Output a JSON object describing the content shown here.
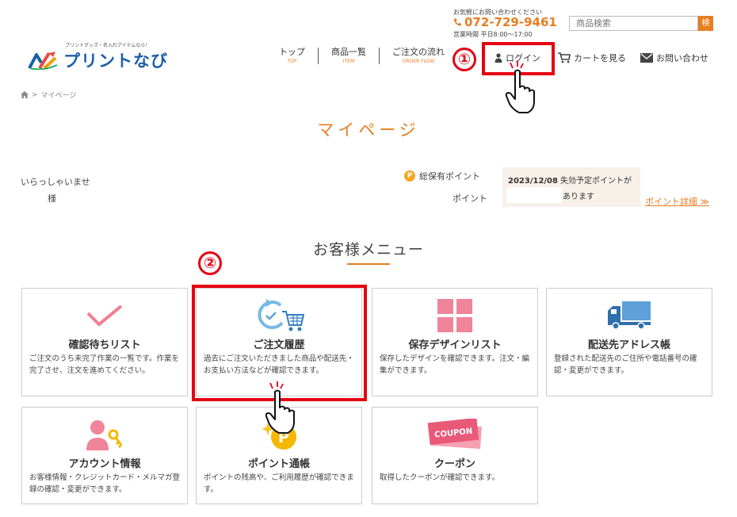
{
  "header": {
    "contact_small": "お気軽にお問い合わせください",
    "phone": "072-729-9461",
    "hours": "営業時間 平日8:00～17:00",
    "search_placeholder": "商品検索",
    "search_button": "検索",
    "logo_tagline": "プリントグッズ・名入れアイテムなら！",
    "logo_text": "プリントなび"
  },
  "nav": [
    {
      "label": "トップ",
      "sub": "TOP"
    },
    {
      "label": "商品一覧",
      "sub": "ITEM"
    },
    {
      "label": "ご注文の流れ",
      "sub": "ORDER FLOW"
    }
  ],
  "header_links": {
    "login": "ログイン",
    "cart": "カートを見る",
    "contact": "お問い合わせ"
  },
  "annotations": {
    "step1": "①",
    "step2": "②"
  },
  "breadcrumb": {
    "current": "マイページ"
  },
  "page_title": "マイページ",
  "welcome": {
    "greeting": "いらっしゃいませ",
    "honorific": "様"
  },
  "points": {
    "icon_letter": "P",
    "title": "総保有ポイント",
    "unit": "ポイント",
    "expiry_date": "2023/12/08",
    "expiry_text": "失効予定ポイントが",
    "expiry_suffix": "あります",
    "detail_link": "ポイント詳細 ≫"
  },
  "menu_title": "お客様メニュー",
  "menu": [
    {
      "title": "確認待ちリスト",
      "desc": "ご注文のうち未完了作業の一覧です。作業を完了させ、注文を進めてください。"
    },
    {
      "title": "ご注文履歴",
      "desc": "過去にご注文いただきました商品や配送先・お支払い方法などが確認できます。"
    },
    {
      "title": "保存デザインリスト",
      "desc": "保存したデザインを確認できます。注文・編集ができます。"
    },
    {
      "title": "配送先アドレス帳",
      "desc": "登録された配送先のご住所や電話番号の確認・変更ができます。"
    },
    {
      "title": "アカウント情報",
      "desc": "お客様情報・クレジットカード・メルマガ登録の確認・変更ができます。"
    },
    {
      "title": "ポイント通帳",
      "desc": "ポイントの残高や、ご利用履歴が確認できます。"
    },
    {
      "title": "クーポン",
      "desc": "取得したクーポンが確認できます。"
    }
  ],
  "coupon_label": "COUPON",
  "colors": {
    "accent": "#e67e22",
    "highlight": "#e60012",
    "brand_blue": "#1d5fa8"
  }
}
